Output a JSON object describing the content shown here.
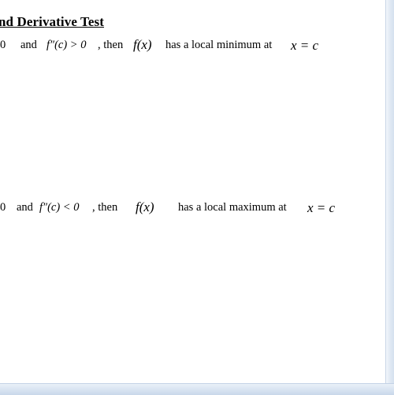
{
  "title": "nd Derivative Test",
  "rule_min": {
    "lead": "0",
    "and": "and",
    "condition": "f″(c) > 0",
    "then": ", then",
    "function": "f(x)",
    "conclusion": "has a local minimum at",
    "point": "x = c"
  },
  "rule_max": {
    "lead": "0",
    "and": "and",
    "condition": "f″(c) < 0",
    "then": ", then",
    "function": "f(x)",
    "conclusion": "has a local maximum at",
    "point": "x = c"
  }
}
